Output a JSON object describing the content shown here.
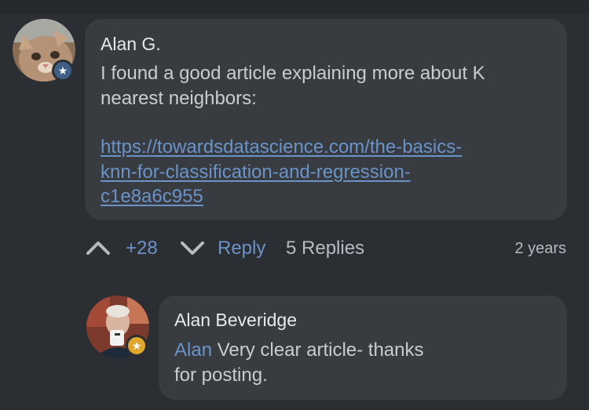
{
  "comment": {
    "author": "Alan G.",
    "text_line1": "I found a good article explaining more about K",
    "text_line2": "nearest neighbors:",
    "link_line1": "https://towardsdatascience.com/the-basics-",
    "link_line2": "knn-for-classification-and-regression-",
    "link_line3": "c1e8a6c955",
    "avatar_icon": "cat-avatar",
    "badge_icon": "star-icon",
    "actions": {
      "votes": "+28",
      "reply_label": "Reply",
      "replies_label": "5 Replies",
      "timestamp": "2 years"
    }
  },
  "reply": {
    "author": "Alan Beveridge",
    "mention": "Alan",
    "text_line1": "Very clear article- thanks",
    "text_line2": "for posting.",
    "badge_icon": "star-icon"
  },
  "colors": {
    "background": "#2b2e33",
    "bubble": "#383b40",
    "link": "#6a93c9",
    "badge_blue": "#3f5f86",
    "badge_gold": "#e0a62e"
  }
}
